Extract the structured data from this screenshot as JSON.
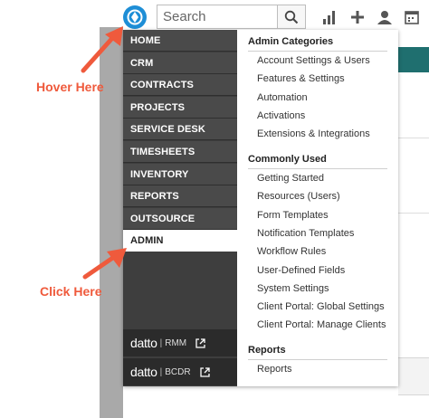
{
  "topbar": {
    "search": {
      "placeholder": "Search"
    },
    "icons": [
      "datto-logo-icon",
      "search-icon",
      "bar-chart-icon",
      "plus-icon",
      "user-icon",
      "calendar-icon"
    ]
  },
  "nav": {
    "items": [
      {
        "label": "HOME",
        "active": false
      },
      {
        "label": "CRM",
        "active": false
      },
      {
        "label": "CONTRACTS",
        "active": false
      },
      {
        "label": "PROJECTS",
        "active": false
      },
      {
        "label": "SERVICE DESK",
        "active": false
      },
      {
        "label": "TIMESHEETS",
        "active": false
      },
      {
        "label": "INVENTORY",
        "active": false
      },
      {
        "label": "REPORTS",
        "active": false
      },
      {
        "label": "OUTSOURCE",
        "active": false
      },
      {
        "label": "ADMIN",
        "active": true
      }
    ],
    "products": [
      {
        "name": "datto",
        "product": "RMM"
      },
      {
        "name": "datto",
        "product": "BCDR"
      }
    ]
  },
  "admin": {
    "sections": [
      {
        "title": "Admin Categories",
        "items": [
          "Account Settings & Users",
          "Features & Settings",
          "Automation",
          "Activations",
          "Extensions & Integrations"
        ]
      },
      {
        "title": "Commonly Used",
        "items": [
          "Getting Started",
          "Resources (Users)",
          "Form Templates",
          "Notification Templates",
          "Workflow Rules",
          "User-Defined Fields",
          "System Settings",
          "Client Portal: Global Settings",
          "Client Portal: Manage Clients"
        ]
      },
      {
        "title": "Reports",
        "items": [
          "Reports"
        ]
      }
    ]
  },
  "annotations": {
    "hover": "Hover Here",
    "click": "Click Here"
  },
  "colors": {
    "nav_bg": "#4a4a4a",
    "accent": "#1e8ed6",
    "annotation": "#ef5a3c",
    "teal": "#1f6f6f"
  }
}
